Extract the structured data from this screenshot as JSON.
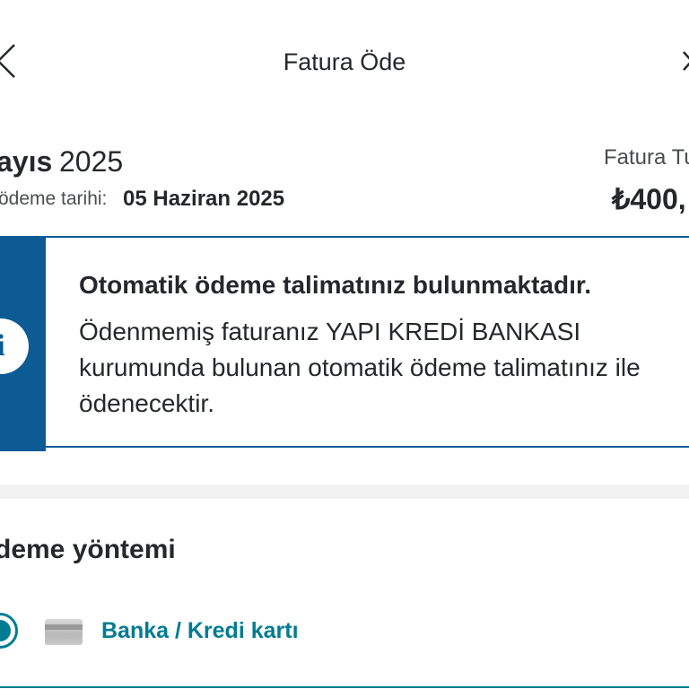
{
  "header": {
    "title": "Fatura Öde",
    "back_icon": "chevron-left-icon",
    "close_icon": "close-icon"
  },
  "bill": {
    "month": "ayıs",
    "year": "2025",
    "due_label": "ödeme tarihi:",
    "due_date": "05 Haziran 2025",
    "amount_label": "Fatura Tu",
    "amount_value": "₺400,"
  },
  "info": {
    "icon": "info-icon",
    "icon_glyph": "i",
    "title": "Otomatik ödeme talimatınız bulunmaktadır.",
    "body": "Ödenmemiş faturanız YAPI KREDİ BANKASI kurumunda bulunan otomatik ödeme talimatınız ile ödenecektir."
  },
  "payment": {
    "title": "deme yöntemi",
    "method_label": "Banka / Kredi kartı",
    "selected": true
  },
  "colors": {
    "info_blue": "#0d5b94",
    "accent_teal": "#007c92",
    "text": "#25282b"
  }
}
